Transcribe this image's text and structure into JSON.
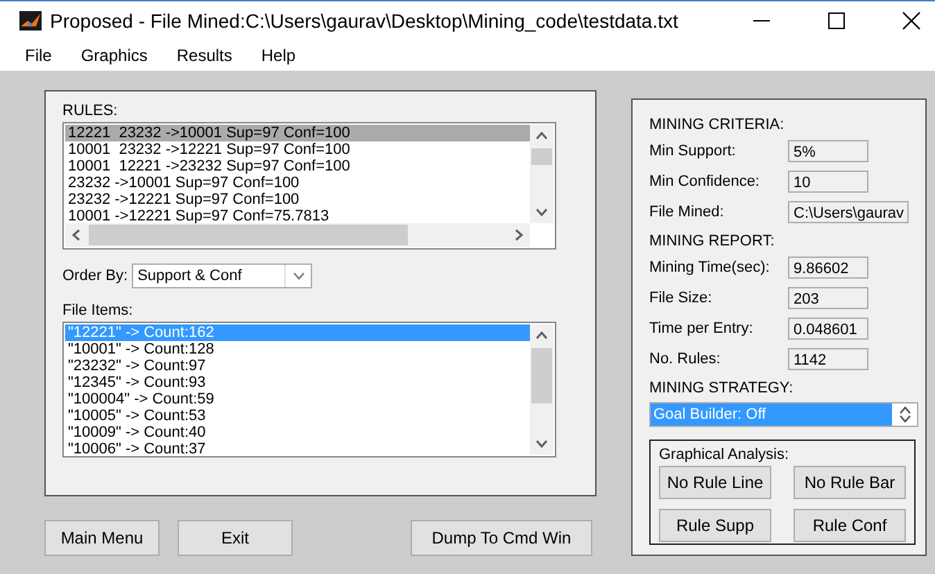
{
  "window": {
    "title": "Proposed - File Mined:C:\\Users\\gaurav\\Desktop\\Mining_code\\testdata.txt"
  },
  "menu": [
    "File",
    "Graphics",
    "Results",
    "Help"
  ],
  "rules": {
    "label": "RULES:",
    "items": [
      {
        "text": "12221  23232 ->10001 Sup=97 Conf=100",
        "selected": true
      },
      {
        "text": "10001  23232 ->12221 Sup=97 Conf=100",
        "selected": false
      },
      {
        "text": "10001  12221 ->23232 Sup=97 Conf=100",
        "selected": false
      },
      {
        "text": "23232 ->10001 Sup=97 Conf=100",
        "selected": false
      },
      {
        "text": "23232 ->12221 Sup=97 Conf=100",
        "selected": false
      },
      {
        "text": "10001 ->12221 Sup=97 Conf=75.7813",
        "selected": false
      }
    ]
  },
  "order_by": {
    "label": "Order By:",
    "value": "Support & Conf"
  },
  "file_items": {
    "label": "File Items:",
    "items": [
      {
        "text": "\"12221\" -> Count:162",
        "selected": true
      },
      {
        "text": "\"10001\" -> Count:128",
        "selected": false
      },
      {
        "text": "\"23232\" -> Count:97",
        "selected": false
      },
      {
        "text": "\"12345\" -> Count:93",
        "selected": false
      },
      {
        "text": "\"100004\" -> Count:59",
        "selected": false
      },
      {
        "text": "\"10005\" -> Count:53",
        "selected": false
      },
      {
        "text": "\"10009\" -> Count:40",
        "selected": false
      },
      {
        "text": "\"10006\" -> Count:37",
        "selected": false
      }
    ]
  },
  "buttons": [
    "Main Menu",
    "Exit",
    "Dump To Cmd Win"
  ],
  "criteria": {
    "heading": "MINING CRITERIA:",
    "fields": [
      {
        "label": "Min Support:",
        "value": "5%"
      },
      {
        "label": "Min Confidence:",
        "value": "10"
      },
      {
        "label": "File Mined:",
        "value": "C:\\Users\\gaurav"
      }
    ]
  },
  "report": {
    "heading": "MINING REPORT:",
    "fields": [
      {
        "label": "Mining Time(sec):",
        "value": "9.86602"
      },
      {
        "label": "File Size:",
        "value": "203"
      },
      {
        "label": "Time per Entry:",
        "value": "0.048601"
      },
      {
        "label": "No. Rules:",
        "value": "1142"
      }
    ]
  },
  "strategy": {
    "heading": "MINING STRATEGY:",
    "value": "Goal Builder: Off"
  },
  "graphical_analysis": {
    "heading": "Graphical Analysis:",
    "buttons": [
      "No Rule Line",
      "No Rule Bar",
      "Rule Supp",
      "Rule Conf"
    ]
  }
}
